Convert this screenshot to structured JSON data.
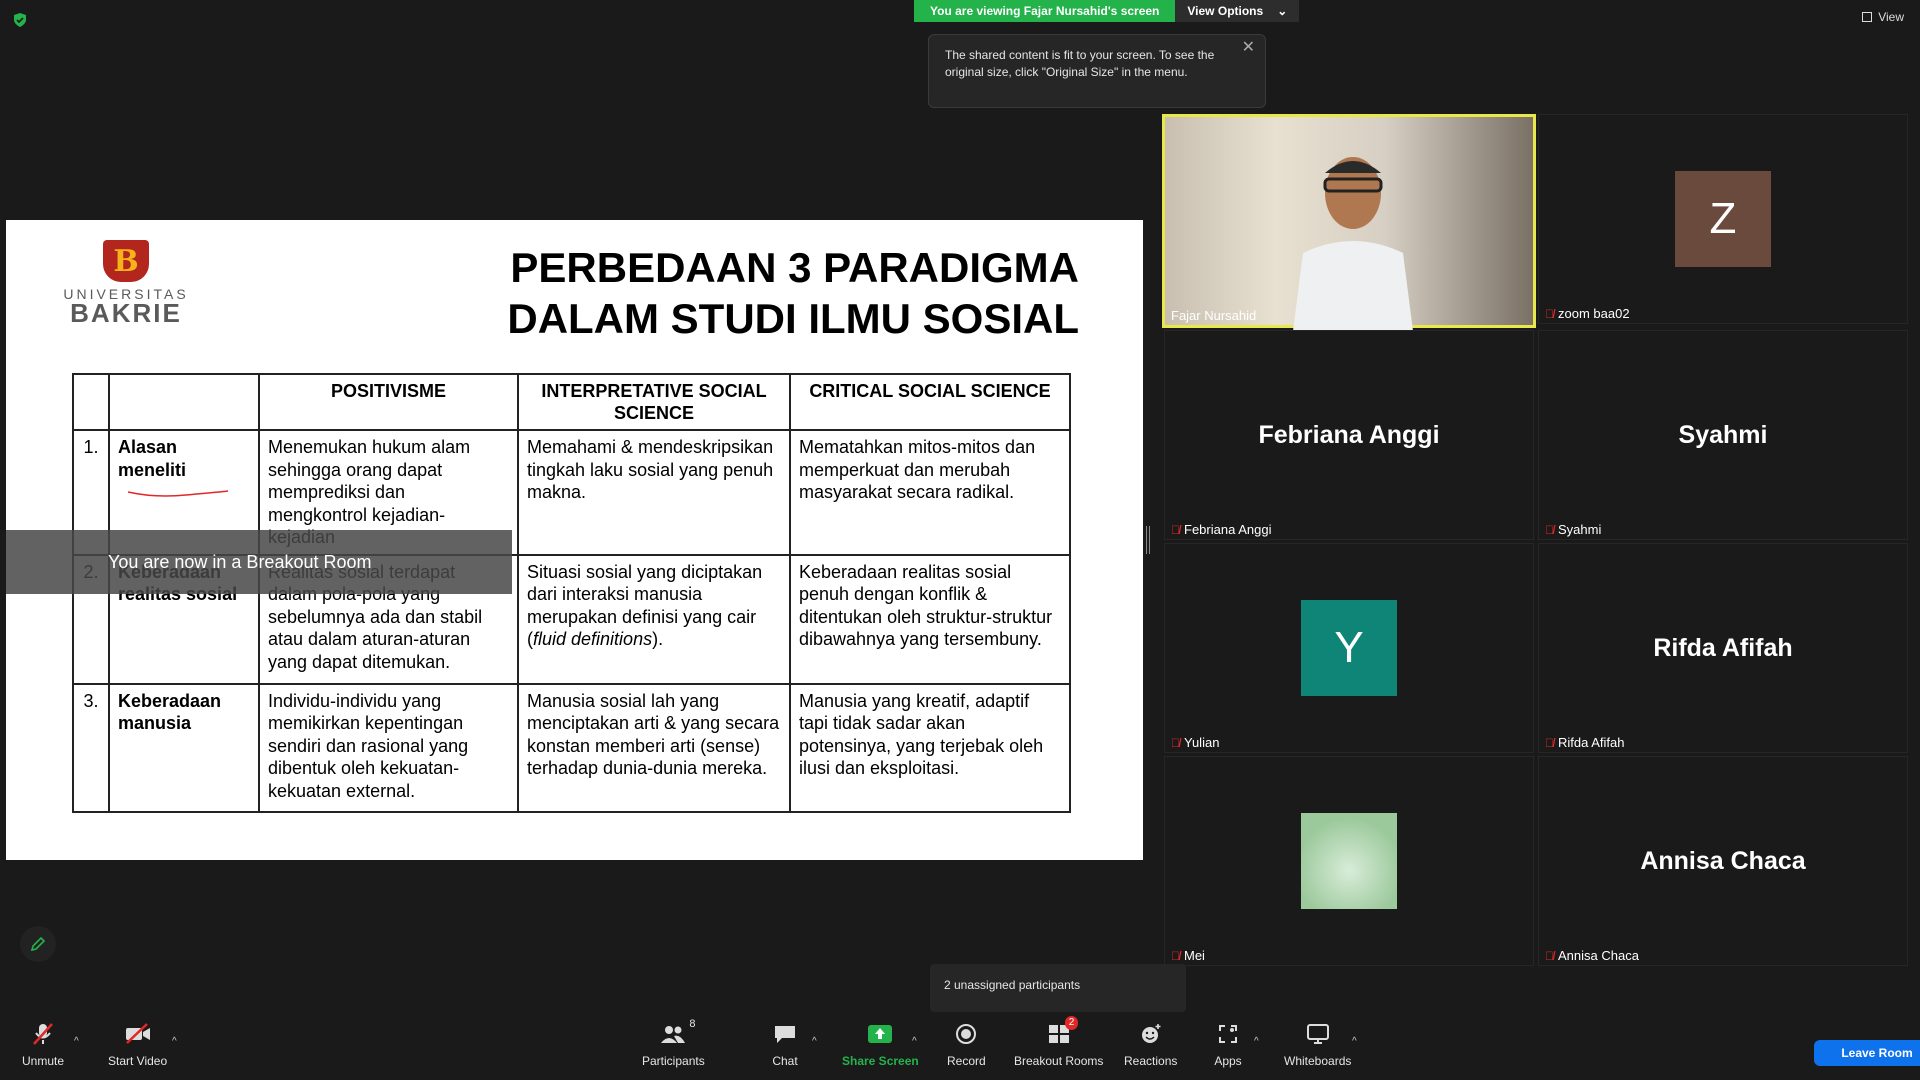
{
  "banner": {
    "viewing": "You are viewing Fajar Nursahid's screen",
    "view_options": "View Options",
    "view_top": "View"
  },
  "tooltip": {
    "text": "The shared content is fit to your screen. To see the original size, click \"Original Size\" in the menu."
  },
  "slide": {
    "logo_universitas": "UNIVERSITAS",
    "logo_bakrie": "BAKRIE",
    "logo_letter": "B",
    "title_line1": "PERBEDAAN 3 PARADIGMA",
    "title_line2": "DALAM STUDI ILMU SOSIAL",
    "table": {
      "headers": [
        "",
        "",
        "POSITIVISME",
        "INTERPRETATIVE SOCIAL SCIENCE",
        "CRITICAL SOCIAL SCIENCE"
      ],
      "rows": [
        {
          "num": "1.",
          "label": "Alasan meneliti",
          "positivisme": "Menemukan hukum alam sehingga orang dapat memprediksi dan mengkontrol kejadian-kejadian",
          "interpretative": "Memahami & mendeskripsikan tingkah laku sosial yang penuh makna.",
          "critical": "Mematahkan mitos-mitos dan memperkuat dan merubah masyarakat secara radikal."
        },
        {
          "num": "2.",
          "label": "Keberadaan realitas sosial",
          "positivisme": "Realitas sosial terdapat dalam pola-pola yang sebelumnya ada dan stabil atau dalam aturan-aturan yang dapat ditemukan.",
          "interpretative_pre": "Situasi sosial yang diciptakan dari interaksi manusia merupakan definisi yang cair (",
          "interpretative_italic": "fluid definitions",
          "interpretative_post": ").",
          "critical": "Keberadaan realitas sosial penuh dengan konflik & ditentukan oleh struktur-struktur dibawahnya yang tersembuny."
        },
        {
          "num": "3.",
          "label": "Keberadaan manusia",
          "positivisme": "Individu-individu yang memikirkan kepentingan sendiri dan rasional yang dibentuk oleh kekuatan-kekuatan external.",
          "interpretative": "Manusia sosial lah yang menciptakan arti & yang secara konstan memberi arti (sense) terhadap dunia-dunia mereka.",
          "critical": "Manusia yang kreatif, adaptif tapi tidak sadar akan potensinya, yang terjebak oleh ilusi dan eksploitasi."
        }
      ]
    }
  },
  "breakout_overlay": "You are now in a Breakout Room",
  "gallery": [
    {
      "name": "Fajar Nursahid",
      "type": "video",
      "muted": false
    },
    {
      "name": "zoom baa02",
      "type": "avatar",
      "avatar_letter": "Z",
      "avatar_color": "#6b4a3e",
      "muted": true
    },
    {
      "name": "Febriana Anggi",
      "type": "name",
      "big": "Febriana Anggi",
      "muted": true
    },
    {
      "name": "Syahmi",
      "type": "name",
      "big": "Syahmi",
      "muted": true
    },
    {
      "name": "Yulian",
      "type": "avatar",
      "avatar_letter": "Y",
      "avatar_color": "#0e8577",
      "muted": true
    },
    {
      "name": "Rifda Afifah",
      "type": "name",
      "big": "Rifda Afifah",
      "muted": true
    },
    {
      "name": "Mei",
      "type": "image",
      "muted": true
    },
    {
      "name": "Annisa Chaca",
      "type": "name",
      "big": "Annisa Chaca",
      "muted": true
    }
  ],
  "unassigned": "2 unassigned participants",
  "toolbar": {
    "unmute": "Unmute",
    "start_video": "Start Video",
    "participants": "Participants",
    "participants_count": "8",
    "chat": "Chat",
    "share_screen": "Share Screen",
    "record": "Record",
    "breakout_rooms": "Breakout Rooms",
    "breakout_badge": "2",
    "reactions": "Reactions",
    "apps": "Apps",
    "whiteboards": "Whiteboards",
    "leave_room": "Leave Room"
  },
  "colors": {
    "accent_green": "#24b34b",
    "active_speaker": "#e8e84a",
    "leave_blue": "#0e72ed",
    "mute_red": "#e02828"
  }
}
